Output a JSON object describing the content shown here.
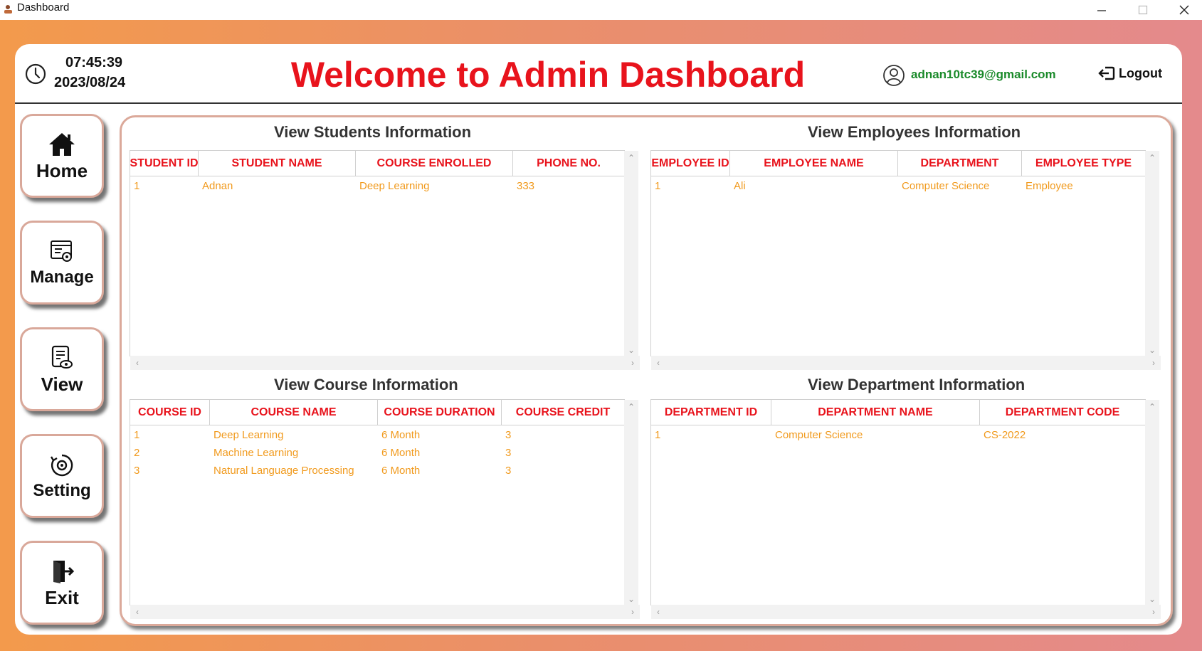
{
  "window": {
    "title": "Dashboard"
  },
  "header": {
    "time": "07:45:39",
    "date": "2023/08/24",
    "welcome": "Welcome to Admin Dashboard",
    "email": "adnan10tc39@gmail.com",
    "logout_label": "Logout"
  },
  "sidebar": {
    "items": [
      {
        "label": "Home",
        "icon": "home-icon"
      },
      {
        "label": "Manage",
        "icon": "manage-icon"
      },
      {
        "label": "View",
        "icon": "view-icon"
      },
      {
        "label": "Setting",
        "icon": "setting-icon"
      },
      {
        "label": "Exit",
        "icon": "exit-icon"
      }
    ]
  },
  "students": {
    "title": "View Students Information",
    "columns": [
      "STUDENT ID",
      "STUDENT NAME",
      "COURSE ENROLLED",
      "PHONE NO."
    ],
    "rows": [
      [
        "1",
        "Adnan",
        "Deep Learning",
        "333"
      ]
    ]
  },
  "employees": {
    "title": "View Employees Information",
    "columns": [
      "EMPLOYEE ID",
      "EMPLOYEE NAME",
      "DEPARTMENT",
      "EMPLOYEE TYPE"
    ],
    "rows": [
      [
        "1",
        "Ali",
        "Computer Science",
        "Employee"
      ]
    ]
  },
  "courses": {
    "title": "View Course Information",
    "columns": [
      "COURSE ID",
      "COURSE NAME",
      "COURSE DURATION",
      "COURSE CREDIT"
    ],
    "rows": [
      [
        "1",
        "Deep Learning",
        "6 Month",
        "3"
      ],
      [
        "2",
        "Machine Learning",
        "6 Month",
        "3"
      ],
      [
        "3",
        "Natural Language Processing",
        "6 Month",
        "3"
      ]
    ]
  },
  "departments": {
    "title": "View Department Information",
    "columns": [
      "DEPARTMENT ID",
      "DEPARTMENT NAME",
      "DEPARTMENT CODE"
    ],
    "rows": [
      [
        "1",
        "Computer Science",
        "CS-2022"
      ]
    ]
  },
  "colors": {
    "accent_red": "#e8131c",
    "cell_orange": "#f19a1d",
    "email_green": "#1a8a2a"
  }
}
